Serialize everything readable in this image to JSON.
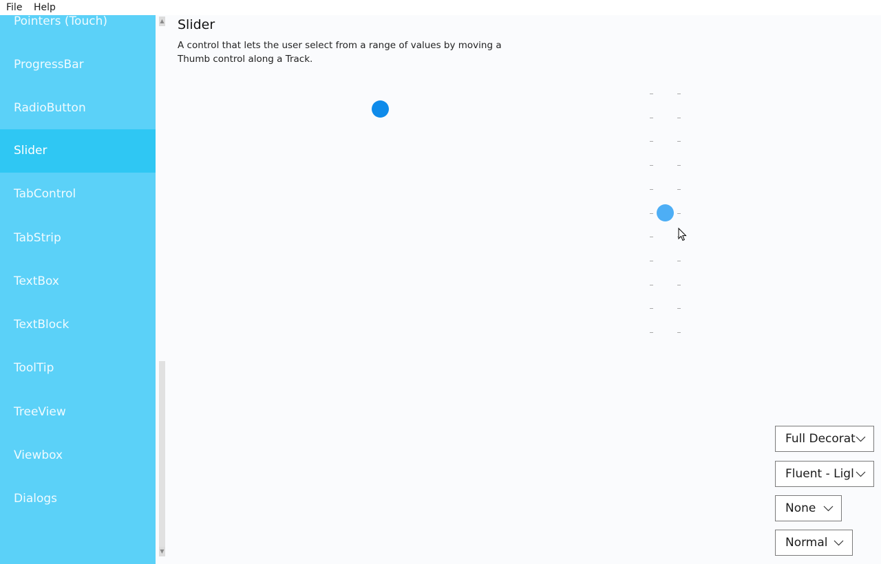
{
  "menu": {
    "file": "File",
    "help": "Help"
  },
  "sidebar": {
    "items": [
      {
        "label": "Pointers (Touch)"
      },
      {
        "label": "ProgressBar"
      },
      {
        "label": "RadioButton"
      },
      {
        "label": "Slider",
        "selected": true
      },
      {
        "label": "TabControl"
      },
      {
        "label": "TabStrip"
      },
      {
        "label": "TextBox"
      },
      {
        "label": "TextBlock"
      },
      {
        "label": "ToolTip"
      },
      {
        "label": "TreeView"
      },
      {
        "label": "Viewbox"
      },
      {
        "label": "Dialogs"
      }
    ]
  },
  "page": {
    "title": "Slider",
    "description": "A control that lets the user select from a range of values by moving a Thumb control along a Track."
  },
  "sliders": {
    "horizontal": {
      "orientation": "horizontal",
      "thumb_color": "#0f8bea"
    },
    "vertical": {
      "orientation": "vertical",
      "thumb_color": "#4daef5",
      "tick_count": 11
    }
  },
  "options": {
    "decorations": {
      "value": "Full Decorat"
    },
    "theme": {
      "value": "Fluent - Ligl"
    },
    "transparency": {
      "value": "None"
    },
    "density": {
      "value": "Normal"
    }
  },
  "colors": {
    "sidebar_bg": "#5bd1f8",
    "sidebar_selected": "#2fc7f3",
    "accent": "#0f8bea"
  }
}
